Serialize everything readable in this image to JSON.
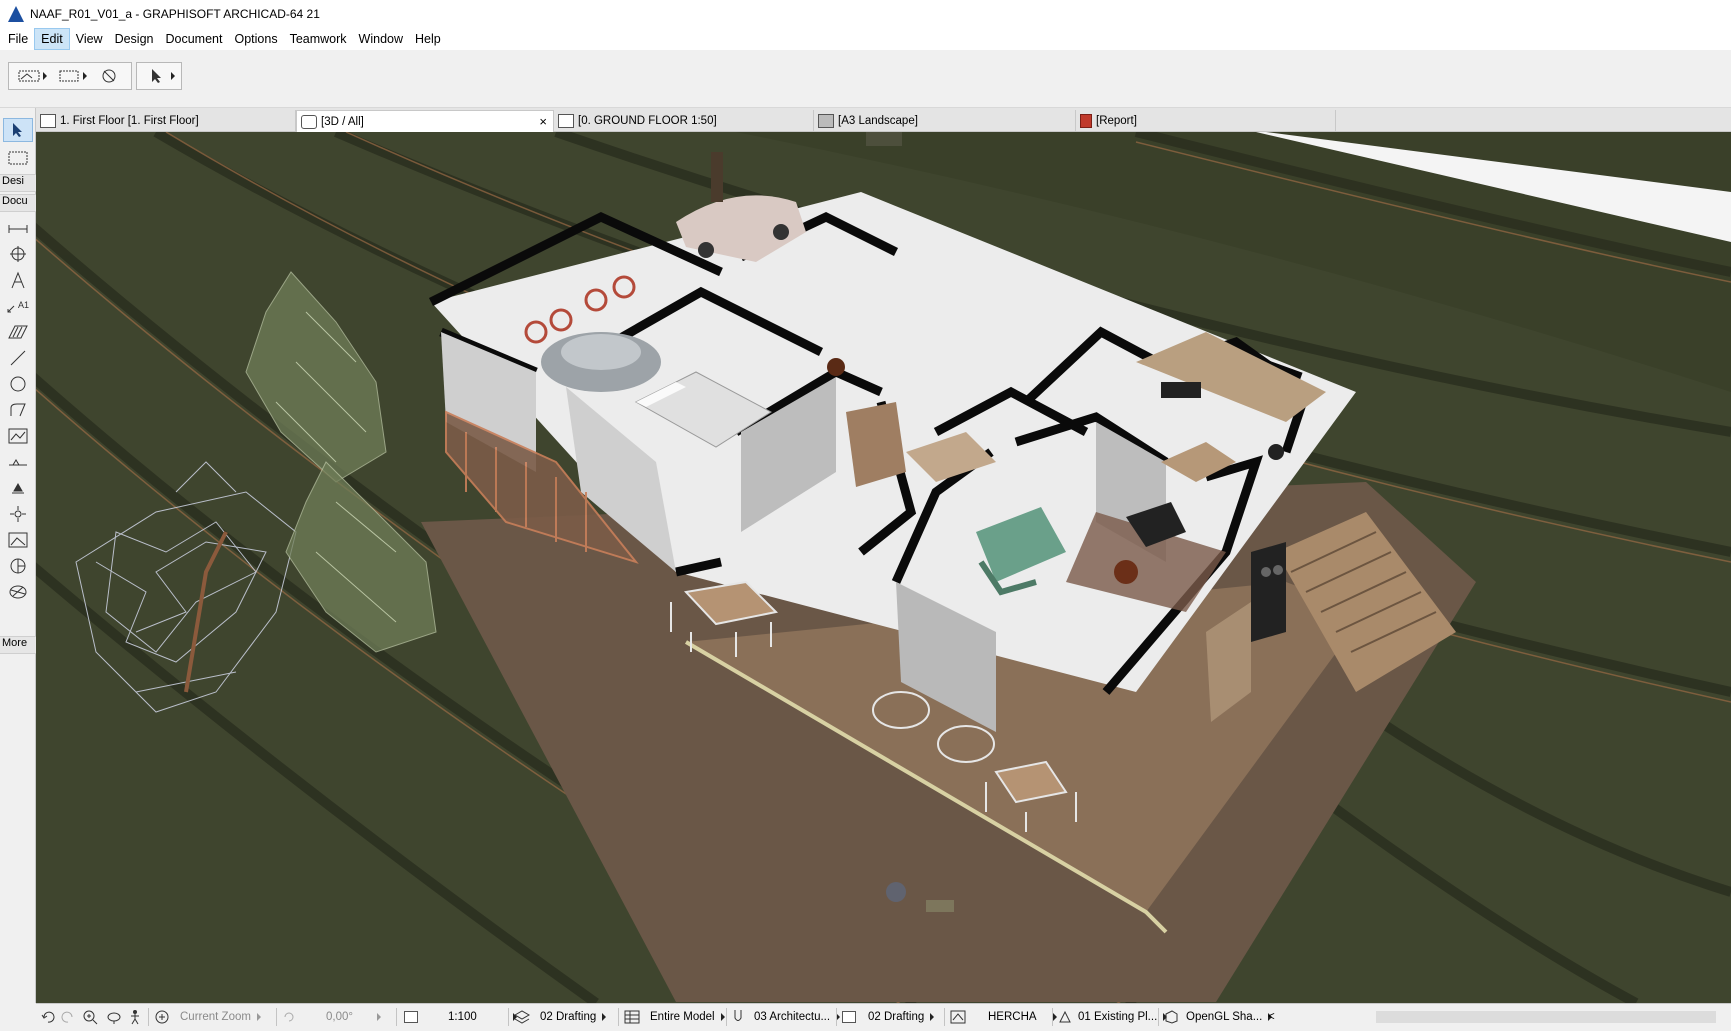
{
  "window": {
    "title": "NAAF_R01_V01_a - GRAPHISOFT ARCHICAD-64 21"
  },
  "menu": {
    "items": [
      "File",
      "Edit",
      "View",
      "Design",
      "Document",
      "Options",
      "Teamwork",
      "Window",
      "Help"
    ],
    "active": "Edit"
  },
  "tabs": [
    {
      "label": "1. First Floor [1. First Floor]",
      "icon": "floorplan-icon"
    },
    {
      "label": "[3D / All]",
      "icon": "3d-window-icon",
      "active": true,
      "close": "×"
    },
    {
      "label": "[0. GROUND FLOOR 1:50]",
      "icon": "section-icon"
    },
    {
      "label": "[A3 Landscape]",
      "icon": "layout-icon"
    },
    {
      "label": "[Report]",
      "icon": "pdf-icon"
    }
  ],
  "toolbox": {
    "sections": [
      "Desi",
      "Docu",
      "More"
    ],
    "tools": [
      "arrow-tool-icon",
      "marquee-tool-icon",
      "dimension-tool-icon",
      "level-dimension-icon",
      "text-tool-icon",
      "label-tool-icon",
      "fill-tool-icon",
      "line-tool-icon",
      "circle-tool-icon",
      "polyline-tool-icon",
      "drawing-tool-icon",
      "elevation-dimension-icon",
      "level-marker-icon",
      "hotspot-tool-icon",
      "figure-tool-icon",
      "section-tool-icon",
      "detail-tool-icon"
    ]
  },
  "statusbar": {
    "zoom_label": "Current Zoom",
    "angle": "0,00°",
    "scale": "1:100",
    "layer_combo": "02 Drafting",
    "model_view": "Entire Model",
    "pen_set": "03 Architectu...",
    "mvo": "02 Drafting",
    "renovation_filter": "HERCHA",
    "graphic_override": "01 Existing Pl...",
    "engine": "OpenGL Sha...",
    "scroll_left": "<"
  }
}
